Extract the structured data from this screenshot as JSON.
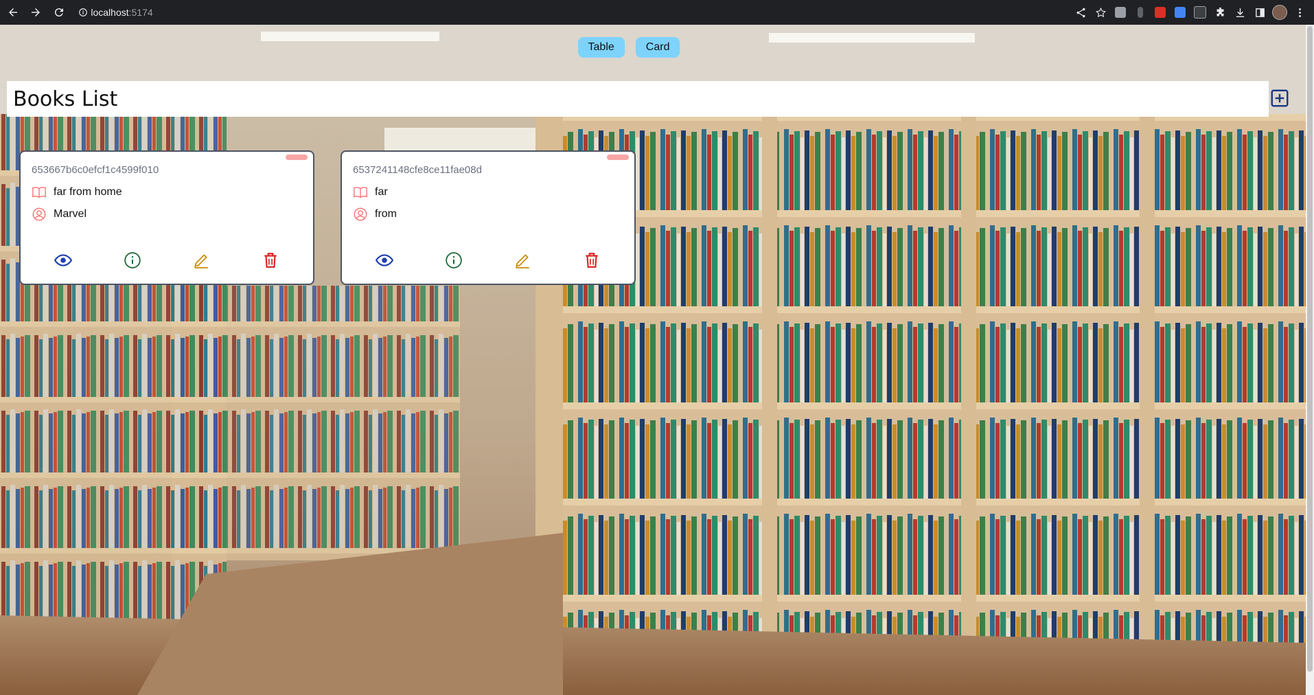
{
  "browser": {
    "url_host": "localhost",
    "url_port": ":5174"
  },
  "toggle": {
    "table_label": "Table",
    "card_label": "Card"
  },
  "header": {
    "title": "Books List"
  },
  "books": [
    {
      "id": "653667b6c0efcf1c4599f010",
      "title": "far from home",
      "author": "Marvel"
    },
    {
      "id": "6537241148cfe8ce11fae08d",
      "title": "far",
      "author": "from"
    }
  ],
  "colors": {
    "toggle_button": "#7dd3fc",
    "view_icon": "#1e40af",
    "info_icon": "#166534",
    "edit_icon": "#ca8a04",
    "delete_icon": "#dc2626",
    "field_icon": "#f87171",
    "add_icon": "#1e3a8a"
  },
  "icons": [
    "back-arrow-icon",
    "forward-arrow-icon",
    "reload-icon",
    "info-icon",
    "share-icon",
    "star-icon",
    "puzzle-icon",
    "download-icon",
    "sidebar-icon",
    "kebab-menu-icon",
    "book-open-icon",
    "user-circle-icon",
    "eye-icon",
    "info-circle-icon",
    "pencil-icon",
    "trash-icon",
    "plus-square-icon"
  ]
}
